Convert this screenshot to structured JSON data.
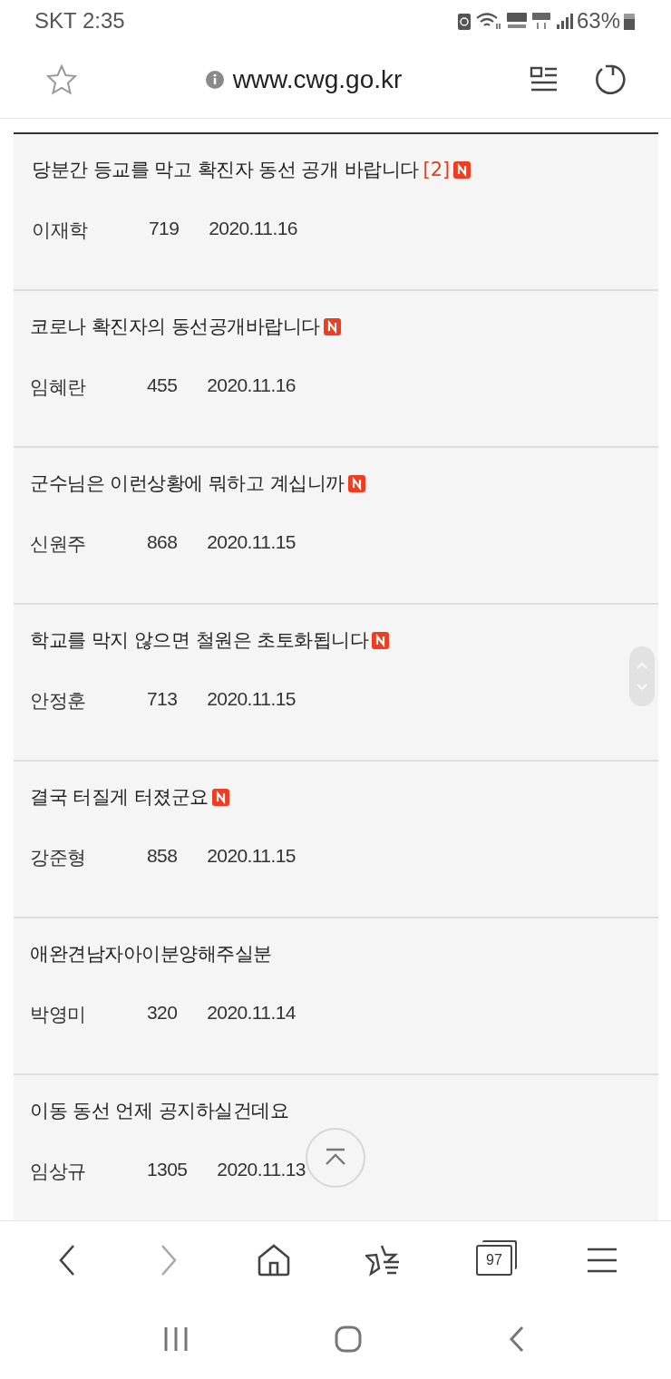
{
  "status_bar": {
    "carrier_time": "SKT 2:35",
    "battery": "63%"
  },
  "browser": {
    "url": "www.cwg.go.kr",
    "tab_count": "97"
  },
  "posts": [
    {
      "title": "당분간 등교를 막고 확진자 동선 공개 바랍니다",
      "comments": "[2]",
      "is_new": true,
      "author": "이재학",
      "views": "719",
      "date": "2020.11.16"
    },
    {
      "title": "코로나 확진자의 동선공개바랍니다",
      "is_new": true,
      "author": "임혜란",
      "views": "455",
      "date": "2020.11.16"
    },
    {
      "title": "군수님은 이런상황에 뭐하고 계십니까",
      "is_new": true,
      "author": "신원주",
      "views": "868",
      "date": "2020.11.15"
    },
    {
      "title": "학교를 막지 않으면 철원은 초토화됩니다",
      "is_new": true,
      "author": "안정훈",
      "views": "713",
      "date": "2020.11.15"
    },
    {
      "title": "결국 터질게 터졌군요",
      "is_new": true,
      "author": "강준형",
      "views": "858",
      "date": "2020.11.15"
    },
    {
      "title": "애완견남자아이분양해주실분",
      "is_new": false,
      "author": "박영미",
      "views": "320",
      "date": "2020.11.14"
    },
    {
      "title": "이동 동선 언제 공지하실건데요",
      "is_new": false,
      "author": "임상규",
      "views": "1305",
      "date": "2020.11.13"
    }
  ]
}
